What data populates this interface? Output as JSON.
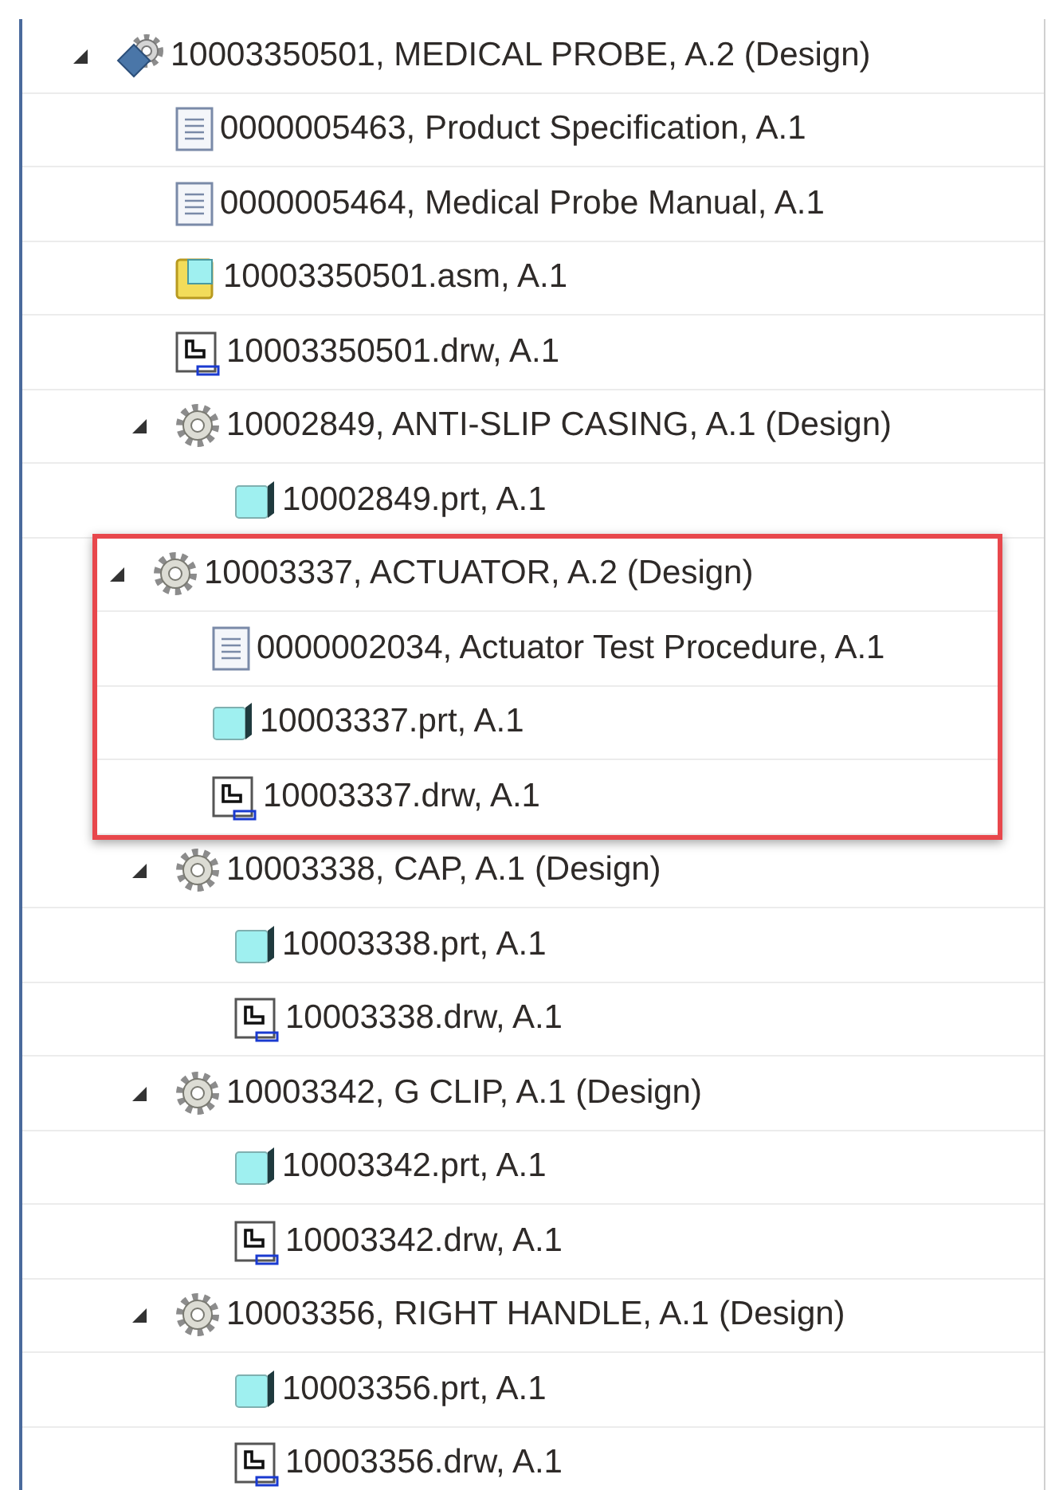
{
  "tree": [
    {
      "kind": "root-assembly",
      "label": "10003350501, MEDICAL PROBE, A.2 (Design)",
      "expanded": true,
      "children": [
        {
          "kind": "document",
          "label": "0000005463, Product Specification, A.1"
        },
        {
          "kind": "document",
          "label": "0000005464, Medical Probe Manual, A.1"
        },
        {
          "kind": "asm",
          "label": "10003350501.asm, A.1"
        },
        {
          "kind": "drawing",
          "label": "10003350501.drw, A.1"
        },
        {
          "kind": "assembly",
          "label": "10002849, ANTI-SLIP CASING, A.1 (Design)",
          "expanded": true,
          "children": [
            {
              "kind": "part",
              "label": "10002849.prt, A.1"
            }
          ]
        },
        {
          "kind": "assembly",
          "label": "10003337, ACTUATOR, A.2 (Design)",
          "expanded": true,
          "highlighted": true,
          "children": [
            {
              "kind": "document",
              "label": "0000002034, Actuator Test Procedure, A.1"
            },
            {
              "kind": "part",
              "label": "10003337.prt, A.1"
            },
            {
              "kind": "drawing",
              "label": "10003337.drw, A.1"
            }
          ]
        },
        {
          "kind": "assembly",
          "label": "10003338, CAP, A.1 (Design)",
          "expanded": true,
          "children": [
            {
              "kind": "part",
              "label": "10003338.prt, A.1"
            },
            {
              "kind": "drawing",
              "label": "10003338.drw, A.1"
            }
          ]
        },
        {
          "kind": "assembly",
          "label": "10003342, G CLIP, A.1 (Design)",
          "expanded": true,
          "children": [
            {
              "kind": "part",
              "label": "10003342.prt, A.1"
            },
            {
              "kind": "drawing",
              "label": "10003342.drw, A.1"
            }
          ]
        },
        {
          "kind": "assembly",
          "label": "10003356, RIGHT HANDLE, A.1 (Design)",
          "expanded": true,
          "children": [
            {
              "kind": "part",
              "label": "10003356.prt, A.1"
            },
            {
              "kind": "drawing",
              "label": "10003356.drw, A.1"
            }
          ]
        }
      ]
    }
  ]
}
